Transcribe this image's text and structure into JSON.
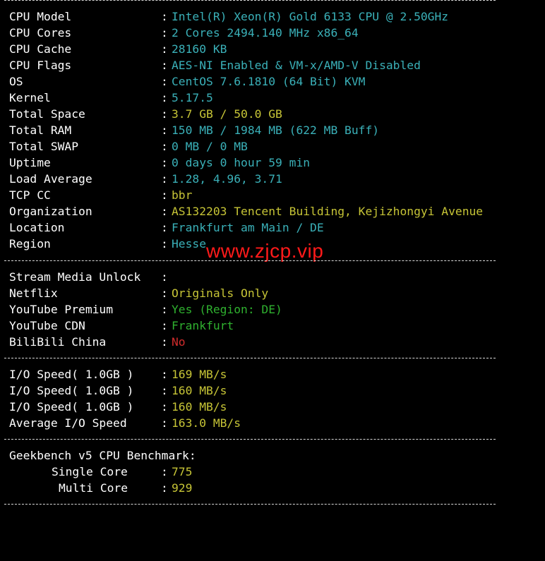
{
  "colors": {
    "background": "#000000",
    "label": "#ffffff",
    "cyan": "#3ab0b8",
    "yellow": "#c6c436",
    "green": "#2fb12f",
    "red": "#d22c2c",
    "watermark": "#ff1a1a"
  },
  "system": [
    {
      "label": "CPU Model",
      "value": "Intel(R) Xeon(R) Gold 6133 CPU @ 2.50GHz",
      "color": "cyan"
    },
    {
      "label": "CPU Cores",
      "value": "2 Cores 2494.140 MHz x86_64",
      "color": "cyan"
    },
    {
      "label": "CPU Cache",
      "value": "28160 KB",
      "color": "cyan"
    },
    {
      "label": "CPU Flags",
      "value": "AES-NI Enabled & VM-x/AMD-V Disabled",
      "color": "cyan"
    },
    {
      "label": "OS",
      "value": "CentOS 7.6.1810 (64 Bit) KVM",
      "color": "cyan"
    },
    {
      "label": "Kernel",
      "value": "5.17.5",
      "color": "cyan"
    },
    {
      "label": "Total Space",
      "value": "3.7 GB / 50.0 GB",
      "color": "yellow"
    },
    {
      "label": "Total RAM",
      "value": "150 MB / 1984 MB (622 MB Buff)",
      "color": "cyan"
    },
    {
      "label": "Total SWAP",
      "value": "0 MB / 0 MB",
      "color": "cyan"
    },
    {
      "label": "Uptime",
      "value": "0 days 0 hour 59 min",
      "color": "cyan"
    },
    {
      "label": "Load Average",
      "value": "1.28, 4.96, 3.71",
      "color": "cyan"
    },
    {
      "label": "TCP CC",
      "value": "bbr",
      "color": "yellow"
    },
    {
      "label": "Organization",
      "value": "AS132203 Tencent Building, Kejizhongyi Avenue",
      "color": "yellow"
    },
    {
      "label": "Location",
      "value": "Frankfurt am Main / DE",
      "color": "cyan"
    },
    {
      "label": "Region",
      "value": "Hesse",
      "color": "cyan"
    }
  ],
  "watermark": "www.zjcp.vip",
  "stream": {
    "heading": "Stream Media Unlock",
    "items": [
      {
        "label": "Netflix",
        "value": "Originals Only",
        "color": "yellow"
      },
      {
        "label": "YouTube Premium",
        "value": "Yes (Region: DE)",
        "color": "green"
      },
      {
        "label": "YouTube CDN",
        "value": "Frankfurt",
        "color": "green"
      },
      {
        "label": "BiliBili China",
        "value": "No",
        "color": "red"
      }
    ]
  },
  "io": [
    {
      "label": "I/O Speed( 1.0GB )",
      "value": "169 MB/s",
      "color": "yellow"
    },
    {
      "label": "I/O Speed( 1.0GB )",
      "value": "160 MB/s",
      "color": "yellow"
    },
    {
      "label": "I/O Speed( 1.0GB )",
      "value": "160 MB/s",
      "color": "yellow"
    },
    {
      "label": "Average I/O Speed",
      "value": "163.0 MB/s",
      "color": "yellow"
    }
  ],
  "geekbench": {
    "heading": "Geekbench v5 CPU Benchmark:",
    "single_label": "Single Core",
    "single_value": "775",
    "multi_label": "Multi Core",
    "multi_value": "929"
  },
  "colon": ":"
}
